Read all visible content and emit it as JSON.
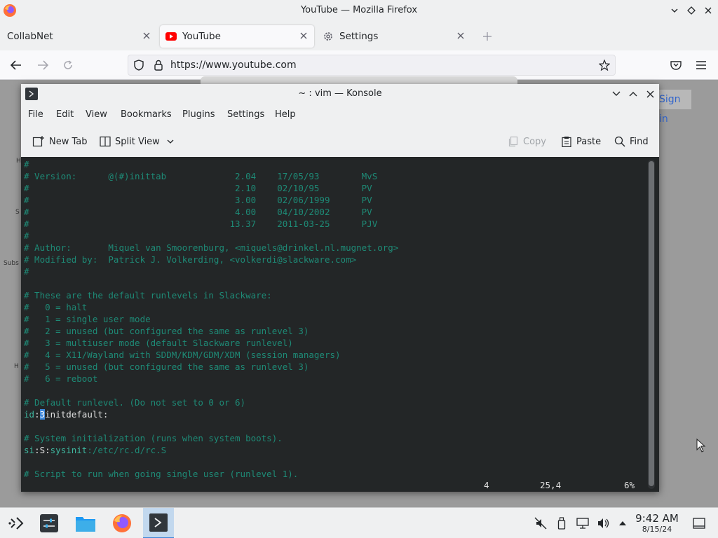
{
  "firefox": {
    "window_title": "YouTube — Mozilla Firefox",
    "tabs": [
      {
        "label": "CollabNet",
        "active": false
      },
      {
        "label": "YouTube",
        "active": true
      },
      {
        "label": "Settings",
        "active": false
      }
    ],
    "url": "https://www.youtube.com",
    "page": {
      "signin_label": "Sign in",
      "side_fragments": [
        "H",
        "S",
        "Subs",
        "H"
      ]
    }
  },
  "konsole": {
    "window_title": "~ : vim — Konsole",
    "menu": [
      "File",
      "Edit",
      "View",
      "Bookmarks",
      "Plugins",
      "Settings",
      "Help"
    ],
    "toolbar": {
      "new_tab": "New Tab",
      "split_view": "Split View",
      "copy": "Copy",
      "paste": "Paste",
      "find": "Find"
    },
    "terminal_lines": [
      {
        "text": "#",
        "kind": "comment"
      },
      {
        "text": "# Version:      @(#)inittab             2.04    17/05/93        MvS",
        "kind": "comment"
      },
      {
        "text": "#                                       2.10    02/10/95        PV",
        "kind": "comment"
      },
      {
        "text": "#                                       3.00    02/06/1999      PV",
        "kind": "comment"
      },
      {
        "text": "#                                       4.00    04/10/2002      PV",
        "kind": "comment"
      },
      {
        "text": "#                                      13.37    2011-03-25      PJV",
        "kind": "comment"
      },
      {
        "text": "#",
        "kind": "comment"
      },
      {
        "text": "# Author:       Miquel van Smoorenburg, <miquels@drinkel.nl.mugnet.org>",
        "kind": "comment"
      },
      {
        "text": "# Modified by:  Patrick J. Volkerding, <volkerdi@slackware.com>",
        "kind": "comment"
      },
      {
        "text": "#",
        "kind": "comment"
      },
      {
        "text": "",
        "kind": "comment"
      },
      {
        "text": "# These are the default runlevels in Slackware:",
        "kind": "comment"
      },
      {
        "text": "#   0 = halt",
        "kind": "comment"
      },
      {
        "text": "#   1 = single user mode",
        "kind": "comment"
      },
      {
        "text": "#   2 = unused (but configured the same as runlevel 3)",
        "kind": "comment"
      },
      {
        "text": "#   3 = multiuser mode (default Slackware runlevel)",
        "kind": "comment"
      },
      {
        "text": "#   4 = X11/Wayland with SDDM/KDM/GDM/XDM (session managers)",
        "kind": "comment"
      },
      {
        "text": "#   5 = unused (but configured the same as runlevel 3)",
        "kind": "comment"
      },
      {
        "text": "#   6 = reboot",
        "kind": "comment"
      },
      {
        "text": "",
        "kind": "comment"
      },
      {
        "text": "# Default runlevel. (Do not set to 0 or 6)",
        "kind": "comment"
      },
      {
        "text": "",
        "kind": "cursorline"
      },
      {
        "text": "",
        "kind": "comment"
      },
      {
        "text": "# System initialization (runs when system boots).",
        "kind": "comment"
      },
      {
        "text": "",
        "kind": "siline"
      },
      {
        "text": "",
        "kind": "comment"
      },
      {
        "text": "# Script to run when going single user (runlevel 1).",
        "kind": "comment"
      }
    ],
    "cursor_line": {
      "before": "id",
      "sep1": ":",
      "cursor_char": "3",
      "rest": "initdefault:"
    },
    "si_line": {
      "a": "si",
      "b": ":S:",
      "c": "sysinit",
      "d": ":/etc/rc.d/rc.S"
    },
    "status": {
      "left": "4",
      "position": "25,4",
      "percent": "6%"
    }
  },
  "taskbar": {
    "time": "9:42 AM",
    "date": "8/15/24",
    "apps": [
      "app-launcher",
      "system-settings",
      "file-manager",
      "firefox",
      "konsole"
    ]
  },
  "colors": {
    "terminal_bg": "#232627",
    "comment": "#1e8a76",
    "accent": "#3d86d8"
  }
}
